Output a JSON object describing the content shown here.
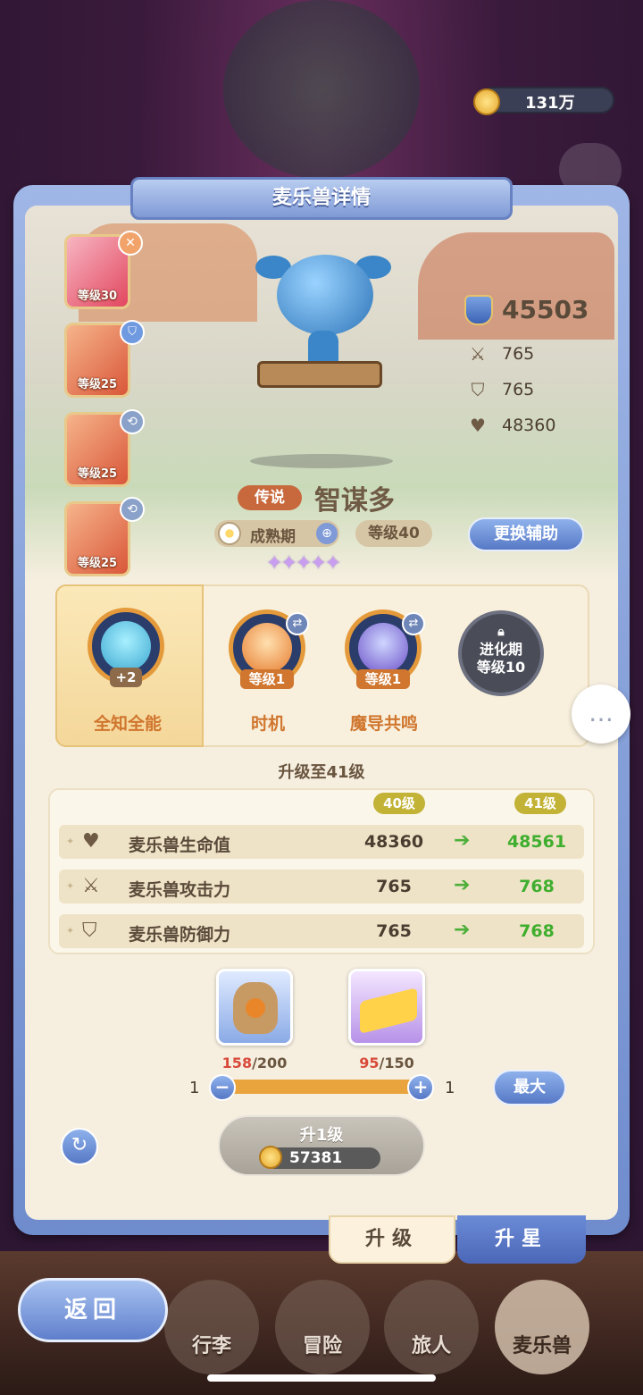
{
  "currency": {
    "amount": "131万",
    "icon": "coin-icon"
  },
  "panel": {
    "title": "麦乐兽详情"
  },
  "helpers": [
    {
      "level": "等级30",
      "badge": "✕",
      "badge_icon": "close-icon"
    },
    {
      "level": "等级25",
      "badge": "⛉",
      "badge_icon": "shield-icon"
    },
    {
      "level": "等级25",
      "badge": "⟲",
      "badge_icon": "link-icon"
    },
    {
      "level": "等级25",
      "badge": "⟲",
      "badge_icon": "link-icon"
    }
  ],
  "stats": {
    "power": "45503",
    "attack": "765",
    "defense": "765",
    "hp": "48360"
  },
  "pet": {
    "rarity": "传说",
    "name": "智谋多",
    "stage": "成熟期",
    "level": "等级40",
    "swap_label": "更换辅助",
    "stars": "✦✦✦✦✦",
    "star_count": 5
  },
  "skills": [
    {
      "name": "全知全能",
      "tag": "+2",
      "selected": true
    },
    {
      "name": "时机",
      "tag": "等级1"
    },
    {
      "name": "魔导共鸣",
      "tag": "等级1"
    }
  ],
  "locked_skill": {
    "line1": "进化期",
    "line2": "等级10"
  },
  "upgrade": {
    "title": "升级至41级",
    "from_label": "40级",
    "to_label": "41级",
    "rows": [
      {
        "name": "麦乐兽生命值",
        "icon": "heart-icon",
        "from": "48360",
        "to": "48561"
      },
      {
        "name": "麦乐兽攻击力",
        "icon": "swords-icon",
        "from": "765",
        "to": "768"
      },
      {
        "name": "麦乐兽防御力",
        "icon": "shield-icon",
        "from": "765",
        "to": "768"
      }
    ]
  },
  "materials": [
    {
      "icon": "food-bag-icon",
      "have": "158",
      "need": "/200"
    },
    {
      "icon": "cheese-icon",
      "have": "95",
      "need": "/150"
    }
  ],
  "slider": {
    "min": "1",
    "max": "1",
    "max_label": "最大"
  },
  "upgrade_button": {
    "label": "升1级",
    "cost": "57381"
  },
  "tabs": {
    "upgrade": "升级",
    "star": "升星"
  },
  "nav": {
    "back": "返回",
    "items": [
      "行李",
      "冒险",
      "旅人",
      "麦乐兽"
    ]
  },
  "colors": {
    "accent": "#5f7fcc",
    "rarity": "#c8693d",
    "increase": "#3fae2e"
  }
}
